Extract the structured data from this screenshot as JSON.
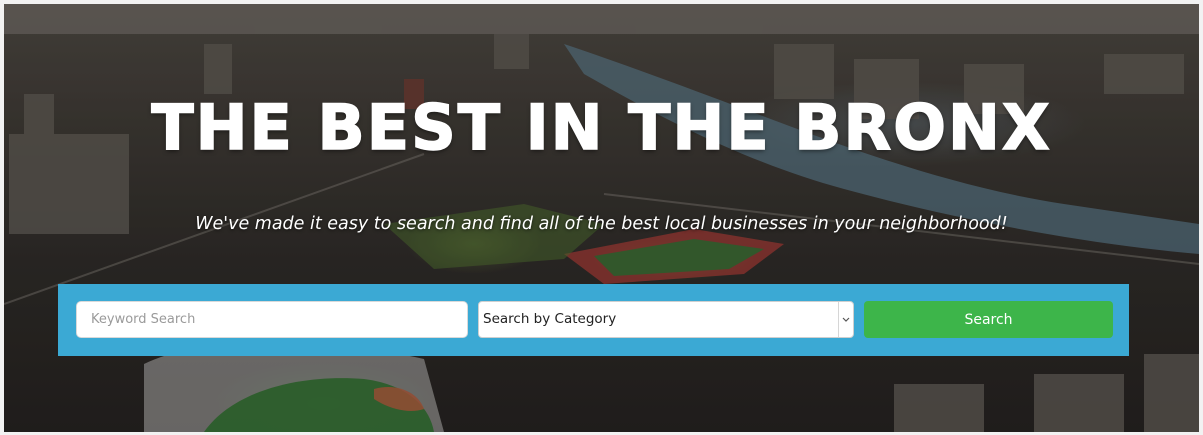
{
  "hero": {
    "title": "THE BEST IN THE BRONX",
    "subtitle": "We've made it easy to search and find all of the best local businesses in your neighborhood!"
  },
  "search": {
    "keyword_placeholder": "Keyword Search",
    "category_selected": "Search by Category",
    "button_label": "Search"
  },
  "colors": {
    "panel": "#3ba9d4",
    "search_button": "#3db54a"
  },
  "icons": {
    "select_arrow": "chevron-down-icon"
  }
}
